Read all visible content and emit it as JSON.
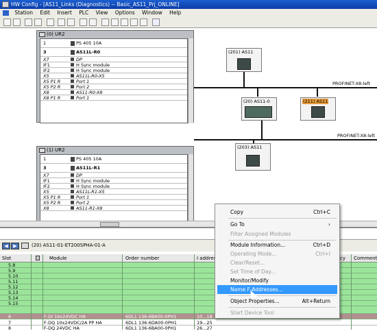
{
  "window": {
    "title": "HW Config - [AS11_Links (Diagnostics) -- Basic_AS11_Prj_ONLINE]"
  },
  "menu": [
    "Station",
    "Edit",
    "Insert",
    "PLC",
    "View",
    "Options",
    "Window",
    "Help"
  ],
  "racks": [
    {
      "title": "(0) UR2",
      "rows": [
        {
          "slot": "1",
          "name": "PS 405 10A",
          "tall": true,
          "bold": false
        },
        {
          "slot": "3",
          "name": "AS11L-R0",
          "tall": true,
          "bold": true
        },
        {
          "slot": "X7",
          "name": "DP",
          "italic": true
        },
        {
          "slot": "IF1",
          "name": "H Sync module"
        },
        {
          "slot": "IF2",
          "name": "H Sync module"
        },
        {
          "slot": "X5",
          "name": "AS11L-R0-X5",
          "italic": true
        },
        {
          "slot": "X5 P1 R",
          "name": "Port 1",
          "italic": true
        },
        {
          "slot": "X5 P2 R",
          "name": "Port 2",
          "italic": true
        },
        {
          "slot": "X8",
          "name": "AS11-R0-X8",
          "italic": true
        },
        {
          "slot": "X8 P1 R",
          "name": "Port 1",
          "italic": true
        }
      ]
    },
    {
      "title": "(1) UR2",
      "rows": [
        {
          "slot": "1",
          "name": "PS 405 10A",
          "tall": true
        },
        {
          "slot": "3",
          "name": "AS11L-R1",
          "tall": true,
          "bold": true
        },
        {
          "slot": "X7",
          "name": "DP",
          "italic": true
        },
        {
          "slot": "IF1",
          "name": "H Sync module"
        },
        {
          "slot": "IF2",
          "name": "H Sync module"
        },
        {
          "slot": "X5",
          "name": "AS11L-R1-X5",
          "italic": true
        },
        {
          "slot": "X5 P1 R",
          "name": "Port 1",
          "italic": true
        },
        {
          "slot": "X5 P2 R",
          "name": "Port 2",
          "italic": true
        },
        {
          "slot": "X8",
          "name": "AS11-R1-X8",
          "italic": true
        }
      ]
    }
  ],
  "devices": {
    "d201": "(201) AS11",
    "d20": "(20) AS11-0",
    "d211": "(211) AS11",
    "d203": "(203) AS11"
  },
  "networks": {
    "upper": "PROFINET-X8-left",
    "lower": "PROFINET-X8-left"
  },
  "station": {
    "label": "(20)  AS11-01-ET200SPHA-01-A"
  },
  "table": {
    "headers": {
      "slot": "Slot",
      "module": "Module",
      "order": "Order number",
      "addr": "I address",
      "dcy": "cy",
      "comment": "Comment"
    },
    "rows": [
      {
        "slot": "5.8",
        "module": "",
        "order": "",
        "addr": ""
      },
      {
        "slot": "5.9",
        "module": "",
        "order": "",
        "addr": ""
      },
      {
        "slot": "5.10",
        "module": "",
        "order": "",
        "addr": ""
      },
      {
        "slot": "5.11",
        "module": "",
        "order": "",
        "addr": ""
      },
      {
        "slot": "5.12",
        "module": "",
        "order": "",
        "addr": ""
      },
      {
        "slot": "5.13",
        "module": "",
        "order": "",
        "addr": ""
      },
      {
        "slot": "5.14",
        "module": "",
        "order": "",
        "addr": ""
      },
      {
        "slot": "5.15",
        "module": "",
        "order": "",
        "addr": ""
      },
      {
        "slot": "6",
        "module": "F-DI 16x24VDC HA",
        "order": "6DL1 136-6BA00-0PH1",
        "addr": "10...18"
      },
      {
        "slot": "7",
        "module": "F-DQ 10x24VDC/2A PP HA",
        "order": "6DL1 136-6DA00-0PH1",
        "addr": "19...25"
      },
      {
        "slot": "8",
        "module": "F-DQ 24VDC HA",
        "order": "6DL1 136-6BA00-0PH1",
        "addr": "26...27"
      }
    ]
  },
  "context_menu": [
    {
      "label": "Copy",
      "shortcut": "Ctrl+C"
    },
    {
      "label": "Go To",
      "arrow": "›"
    },
    {
      "label": "Filter Assigned Modules",
      "disabled": true
    },
    {
      "label": "Module Information...",
      "shortcut": "Ctrl+D"
    },
    {
      "label": "Operating Mode...",
      "shortcut": "Ctrl+I",
      "disabled": true
    },
    {
      "label": "Clear/Reset...",
      "disabled": true
    },
    {
      "label": "Set Time of Day...",
      "disabled": true
    },
    {
      "label": "Monitor/Modify"
    },
    {
      "label": "Name F-Addresses...",
      "highlighted": true
    },
    {
      "label": "Object Properties...",
      "shortcut": "Alt+Return"
    },
    {
      "label": "Start Device Tool",
      "disabled": true
    }
  ]
}
